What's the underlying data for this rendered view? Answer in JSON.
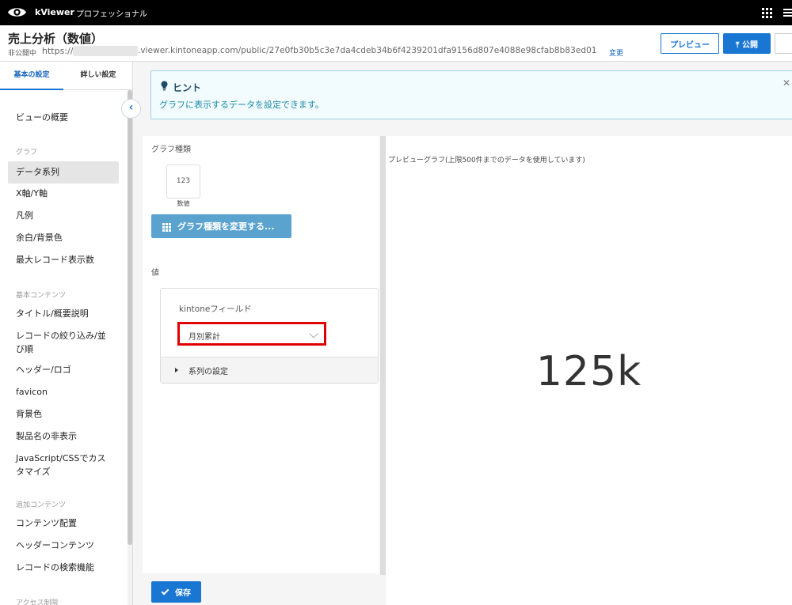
{
  "topbar": {
    "brand": "kViewer",
    "edition": "プロフェッショナル"
  },
  "header": {
    "title": "売上分析（数値）",
    "status": "非公開中",
    "url_prefix": "https://",
    "url_rest": ".viewer.kintoneapp.com/public/27e0fb30b5c3e7da4cdeb34b6f4239201dfa9156d807e4088e98cfab8b83ed01",
    "change_label": "変更",
    "preview_label": "プレビュー",
    "publish_label": "公開"
  },
  "sidebar": {
    "tabs": [
      "基本の設定",
      "詳しい設定"
    ],
    "items": [
      {
        "type": "item",
        "label": "ビューの概要"
      },
      {
        "type": "heading",
        "label": "グラフ"
      },
      {
        "type": "item",
        "label": "データ系列",
        "active": true
      },
      {
        "type": "item",
        "label": "X軸/Y軸"
      },
      {
        "type": "item",
        "label": "凡例"
      },
      {
        "type": "item",
        "label": "余白/背景色"
      },
      {
        "type": "item",
        "label": "最大レコード表示数"
      },
      {
        "type": "heading",
        "label": "基本コンテンツ"
      },
      {
        "type": "item",
        "label": "タイトル/概要説明"
      },
      {
        "type": "item",
        "label": "レコードの絞り込み/並び順"
      },
      {
        "type": "item",
        "label": "ヘッダー/ロゴ"
      },
      {
        "type": "item",
        "label": "favicon"
      },
      {
        "type": "item",
        "label": "背景色"
      },
      {
        "type": "item",
        "label": "製品名の非表示"
      },
      {
        "type": "item",
        "label": "JavaScript/CSSでカスタマイズ"
      },
      {
        "type": "heading",
        "label": "追加コンテンツ"
      },
      {
        "type": "item",
        "label": "コンテンツ配置"
      },
      {
        "type": "item",
        "label": "ヘッダーコンテンツ"
      },
      {
        "type": "item",
        "label": "レコードの検索機能"
      },
      {
        "type": "heading",
        "label": "アクセス制限"
      }
    ]
  },
  "hint": {
    "title": "ヒント",
    "text": "グラフに表示するデータを設定できます。",
    "close": "✕"
  },
  "settings": {
    "graph_type_label": "グラフ種類",
    "type_icon_text": "123",
    "type_caption": "数値",
    "change_button": "グラフ種類を変更する...",
    "value_label": "値",
    "field_label": "kintoneフィールド",
    "selected_field": "月別累計",
    "series_settings": "系列の設定"
  },
  "preview": {
    "caption": "プレビューグラフ(上限500件までのデータを使用しています)",
    "value": "125k"
  },
  "footer": {
    "save_label": "保存"
  }
}
